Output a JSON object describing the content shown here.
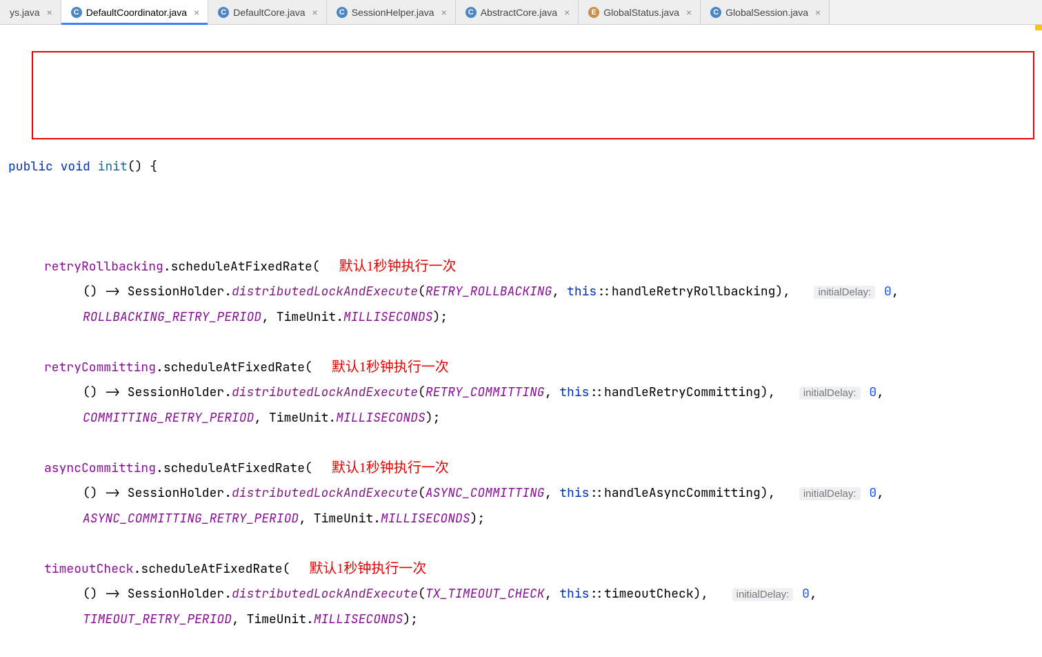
{
  "tabs": [
    {
      "icon": "",
      "kind": "none",
      "label": "ys.java",
      "active": false
    },
    {
      "icon": "C",
      "kind": "class",
      "label": "DefaultCoordinator.java",
      "active": true
    },
    {
      "icon": "C",
      "kind": "class",
      "label": "DefaultCore.java",
      "active": false
    },
    {
      "icon": "C",
      "kind": "class",
      "label": "SessionHelper.java",
      "active": false
    },
    {
      "icon": "C",
      "kind": "class",
      "label": "AbstractCore.java",
      "active": false
    },
    {
      "icon": "E",
      "kind": "enum",
      "label": "GlobalStatus.java",
      "active": false
    },
    {
      "icon": "C",
      "kind": "class",
      "label": "GlobalSession.java",
      "active": false
    }
  ],
  "code": {
    "sig_kw1": "public",
    "sig_kw2": "void",
    "sig_name": "init",
    "sig_parens": "() {",
    "blocks": [
      {
        "field": "retryRollbacking",
        "schedule": "scheduleAtFixedRate",
        "annot": "默认1秒钟执行一次",
        "open": "(",
        "lambda_open": "() -> SessionHolder.",
        "lambda_call": "distributedLockAndExecute",
        "lambda_arg1": "RETRY_ROLLBACKING",
        "lambda_this": "this",
        "lambda_ref": "::handleRetryRollbacking",
        "lambda_close": "),",
        "hint": "initialDelay:",
        "hint_val": "0",
        "tail_const": "ROLLBACKING_RETRY_PERIOD",
        "tail_mid": ", TimeUnit.",
        "tail_unit": "MILLISECONDS",
        "tail_close": ");"
      },
      {
        "field": "retryCommitting",
        "schedule": "scheduleAtFixedRate",
        "annot": "默认1秒钟执行一次",
        "open": "(",
        "lambda_open": "() -> SessionHolder.",
        "lambda_call": "distributedLockAndExecute",
        "lambda_arg1": "RETRY_COMMITTING",
        "lambda_this": "this",
        "lambda_ref": "::handleRetryCommitting",
        "lambda_close": "),",
        "hint": "initialDelay:",
        "hint_val": "0",
        "tail_const": "COMMITTING_RETRY_PERIOD",
        "tail_mid": ", TimeUnit.",
        "tail_unit": "MILLISECONDS",
        "tail_close": ");"
      },
      {
        "field": "asyncCommitting",
        "schedule": "scheduleAtFixedRate",
        "annot": "默认1秒钟执行一次",
        "open": "(",
        "lambda_open": "() -> SessionHolder.",
        "lambda_call": "distributedLockAndExecute",
        "lambda_arg1": "ASYNC_COMMITTING",
        "lambda_this": "this",
        "lambda_ref": "::handleAsyncCommitting",
        "lambda_close": "),",
        "hint": "initialDelay:",
        "hint_val": "0",
        "tail_const": "ASYNC_COMMITTING_RETRY_PERIOD",
        "tail_mid": ", TimeUnit.",
        "tail_unit": "MILLISECONDS",
        "tail_close": ");"
      },
      {
        "field": "timeoutCheck",
        "schedule": "scheduleAtFixedRate",
        "annot": "默认1秒钟执行一次",
        "open": "(",
        "lambda_open": "() -> SessionHolder.",
        "lambda_call": "distributedLockAndExecute",
        "lambda_arg1": "TX_TIMEOUT_CHECK",
        "lambda_this": "this",
        "lambda_ref": "::timeoutCheck",
        "lambda_close": "),",
        "hint": "initialDelay:",
        "hint_val": "0",
        "tail_const": "TIMEOUT_RETRY_PERIOD",
        "tail_mid": ", TimeUnit.",
        "tail_unit": "MILLISECONDS",
        "tail_close": ");"
      }
    ]
  }
}
